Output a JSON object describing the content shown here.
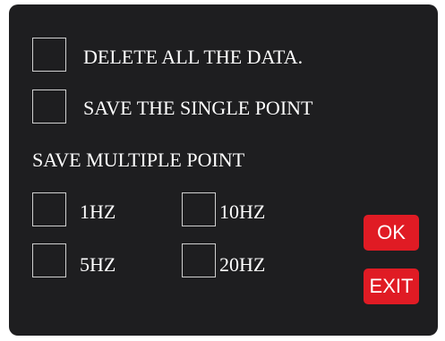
{
  "options": {
    "delete_all": {
      "label": "DELETE ALL THE DATA.",
      "checked": false
    },
    "save_single": {
      "label": "SAVE THE SINGLE POINT",
      "checked": false
    }
  },
  "multiple": {
    "heading": "SAVE MULTIPLE POINT",
    "rates": [
      {
        "label": "1HZ",
        "checked": false
      },
      {
        "label": "10HZ",
        "checked": false
      },
      {
        "label": "5HZ",
        "checked": false
      },
      {
        "label": "20HZ",
        "checked": false
      }
    ]
  },
  "buttons": {
    "ok": "OK",
    "exit": "EXIT"
  },
  "colors": {
    "panel": "#1e1e20",
    "accent": "#e01b24",
    "text": "#ffffff",
    "checkbox_border": "#cfcfcf"
  }
}
